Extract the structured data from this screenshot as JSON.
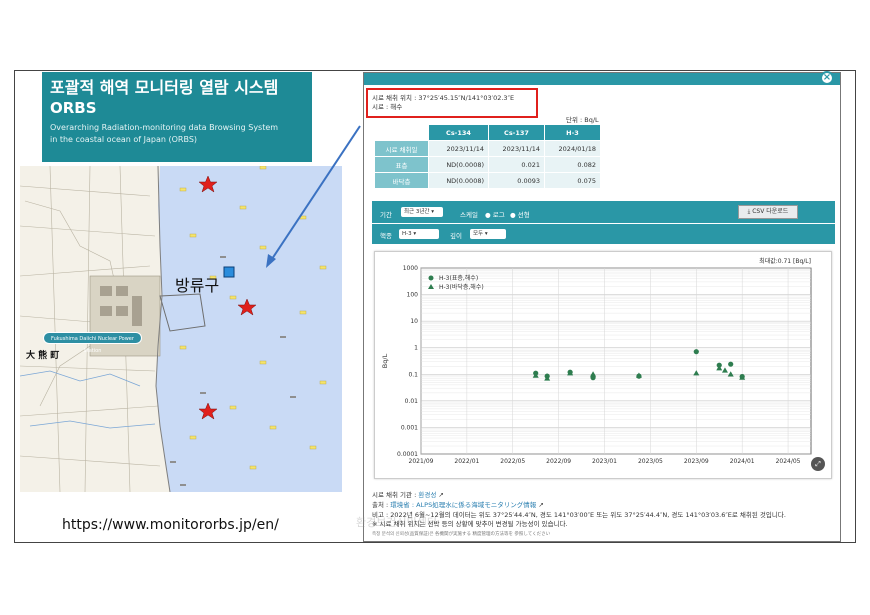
{
  "banner": {
    "title_ko": "포괄적 해역 모니터링 열람 시스템",
    "title_en": "ORBS",
    "subtitle_1": "Overarching Radiation-monitoring data Browsing System",
    "subtitle_2": "in the coastal ocean of Japan (ORBS)"
  },
  "map": {
    "discharge_label": "방류구",
    "town_label": "大 熊 町",
    "plant_label": "Fukushima Daiichi Nuclear Power Station"
  },
  "url": "https://www.monitororbs.jp/en/",
  "popup": {
    "location_line": "시료 채취 위치 : 37°25′45.15″N/141°03′02.3″E",
    "sample_line": "시료 : 해수",
    "unit": "단위 : Bq/L",
    "close": "×",
    "table": {
      "headers": [
        "",
        "Cs-134",
        "Cs-137",
        "H-3"
      ],
      "rows": [
        {
          "label": "시료 채취일",
          "values": [
            "2023/11/14",
            "2023/11/14",
            "2024/01/18"
          ]
        },
        {
          "label": "표층",
          "values": [
            "ND(0.0008)",
            "0.021",
            "0.082"
          ]
        },
        {
          "label": "바닥층",
          "values": [
            "ND(0.0008)",
            "0.0093",
            "0.075"
          ]
        }
      ]
    },
    "controls": {
      "period_label": "기간",
      "period_value": "최근 3년간",
      "scale_label": "스케일",
      "scale_log": "로그",
      "scale_linear": "선형",
      "csv": "CSV 다운로드",
      "nuclide_label": "핵종",
      "nuclide_value": "H-3",
      "depth_label": "깊이",
      "depth_value": "모두"
    },
    "footer": {
      "agency_label": "시료 채취 기관 :",
      "agency_value": "환경성",
      "source_label": "출처 :",
      "source_value": "環境省 : ALPS処理水に係る海域モニタリング情報",
      "note": "비고 : 2022년 6월~12월의 데이터는 위도 37°25′44.4″N, 경도 141°03′00″E 또는 위도 37°25′44.4″N, 경도 141°03′03.6″E로 채취된 것입니다.",
      "note2": "※ 시료 채취 위치는 선박 등의 상황에 맞추어 변경될 가능성이 있습니다.",
      "tiny": "측정 분석의 신뢰성(品質保証)은 各機関が実施する 精度管理の方法等を 参照してください"
    },
    "watermark": "환경보건시민센터"
  },
  "chart_data": {
    "type": "scatter",
    "title": "",
    "max_label": "최대값:0.71 [Bq/L]",
    "ylabel": "Bq/L",
    "xlabel": "",
    "yscale": "log",
    "ylim": [
      0.0001,
      1000
    ],
    "yticks": [
      "1000",
      "100",
      "10",
      "1",
      "0.1",
      "0.01",
      "0.001",
      "0.0001"
    ],
    "xticks": [
      "2021/09",
      "2022/01",
      "2022/05",
      "2022/09",
      "2023/01",
      "2023/05",
      "2023/09",
      "2024/01",
      "2024/05"
    ],
    "xlim": [
      "2021/09",
      "2024/07"
    ],
    "legend_position": "top-left",
    "series": [
      {
        "name": "H-3(표층,해수)",
        "marker": "circle",
        "color": "#2e7d4f",
        "points": [
          {
            "x": "2022/07",
            "y": 0.11
          },
          {
            "x": "2022/08",
            "y": 0.085
          },
          {
            "x": "2022/10",
            "y": 0.12
          },
          {
            "x": "2022/12",
            "y": 0.075
          },
          {
            "x": "2023/04",
            "y": 0.085
          },
          {
            "x": "2023/09",
            "y": 0.71
          },
          {
            "x": "2023/11",
            "y": 0.22
          },
          {
            "x": "2023/12",
            "y": 0.24
          },
          {
            "x": "2024/01",
            "y": 0.082
          }
        ]
      },
      {
        "name": "H-3(바닥층,해수)",
        "marker": "triangle",
        "color": "#2e7d4f",
        "points": [
          {
            "x": "2022/07",
            "y": 0.09
          },
          {
            "x": "2022/08",
            "y": 0.07
          },
          {
            "x": "2022/10",
            "y": 0.11
          },
          {
            "x": "2022/12",
            "y": 0.1
          },
          {
            "x": "2023/04",
            "y": 0.09
          },
          {
            "x": "2023/09",
            "y": 0.11
          },
          {
            "x": "2023/11",
            "y": 0.17
          },
          {
            "x": "2023/11b",
            "y": 0.14
          },
          {
            "x": "2023/12",
            "y": 0.1
          },
          {
            "x": "2024/01",
            "y": 0.075
          }
        ]
      }
    ]
  }
}
